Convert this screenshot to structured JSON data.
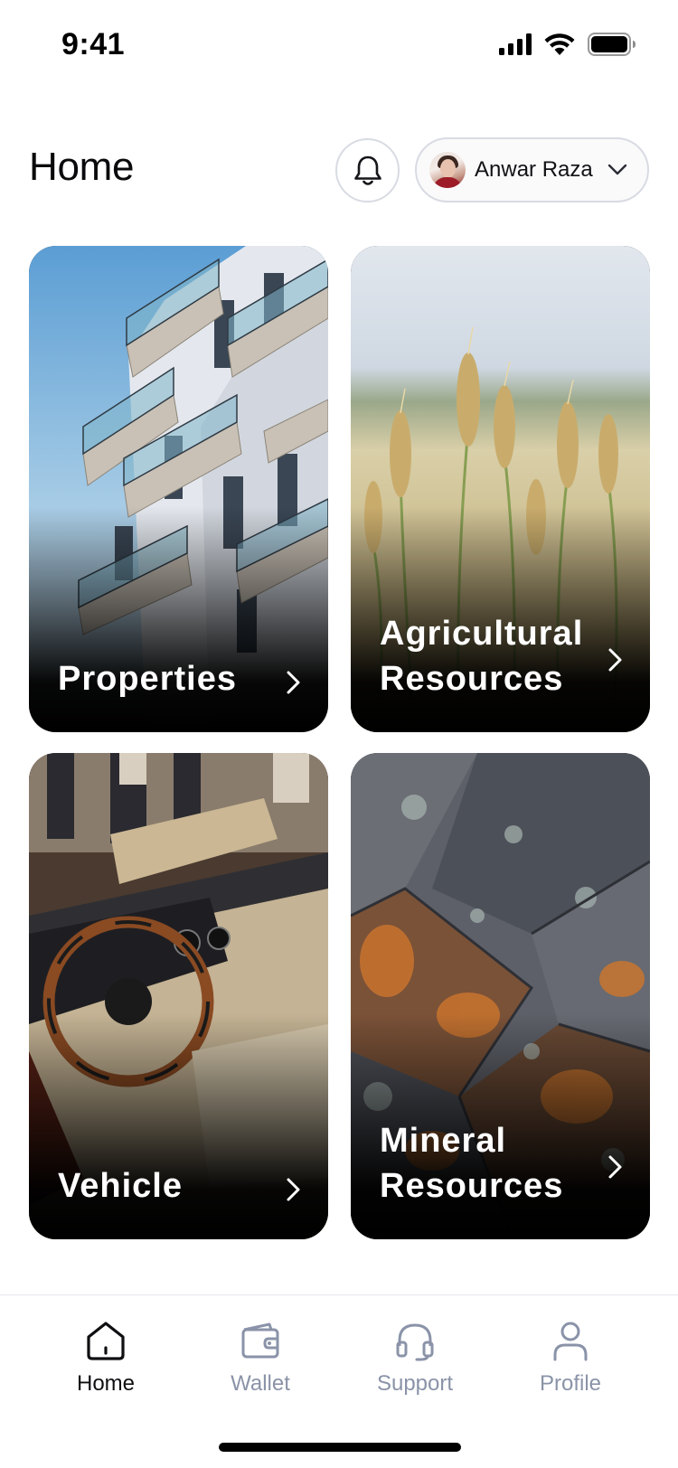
{
  "status_bar": {
    "time": "9:41"
  },
  "header": {
    "title": "Home",
    "user_name": "Anwar Raza"
  },
  "cards": {
    "properties": {
      "label": "Properties"
    },
    "agricultural": {
      "label": "Agricultural\nResources"
    },
    "vehicle": {
      "label": "Vehicle"
    },
    "mineral": {
      "label": "Mineral\nResources"
    }
  },
  "nav": {
    "items": [
      {
        "label": "Home",
        "icon": "home-icon",
        "active": true
      },
      {
        "label": "Wallet",
        "icon": "wallet-icon",
        "active": false
      },
      {
        "label": "Support",
        "icon": "headset-icon",
        "active": false
      },
      {
        "label": "Profile",
        "icon": "user-icon",
        "active": false
      }
    ]
  },
  "colors": {
    "text": "#0f0f12",
    "inactive": "#8a93a8",
    "border": "#d8dbe2"
  }
}
